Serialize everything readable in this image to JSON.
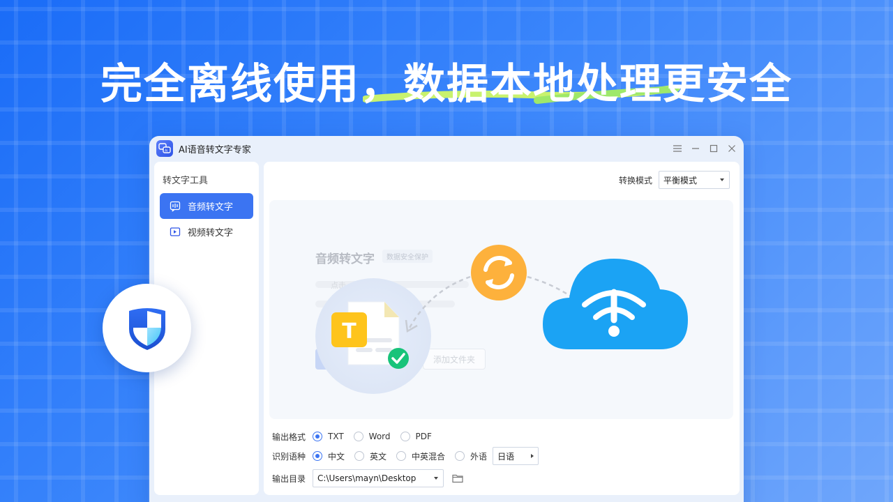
{
  "headline": "完全离线使用，数据本地处理更安全",
  "app": {
    "title": "AI语音转文字专家",
    "logo_text": "Ai"
  },
  "sidebar": {
    "heading": "转文字工具",
    "items": [
      {
        "label": "音频转文字",
        "active": true,
        "icon": "audio-text-icon"
      },
      {
        "label": "视频转文字",
        "active": false,
        "icon": "video-text-icon"
      }
    ]
  },
  "mode": {
    "label": "转换模式",
    "value": "平衡模式"
  },
  "drop_area": {
    "title": "音频转文字",
    "badge": "数据安全保护",
    "line_text": "点击",
    "add_folder": "添加文件夹",
    "doc_letter": "T"
  },
  "output_format": {
    "label": "输出格式",
    "options": [
      "TXT",
      "Word",
      "PDF"
    ],
    "selected": "TXT"
  },
  "language": {
    "label": "识别语种",
    "options": [
      "中文",
      "英文",
      "中英混合",
      "外语"
    ],
    "selected": "中文",
    "foreign_value": "日语"
  },
  "output_dir": {
    "label": "输出目录",
    "value": "C:\\Users\\mayn\\Desktop"
  },
  "colors": {
    "accent": "#3b74f2",
    "sync": "#fdb13c",
    "cloud": "#1ba3f4",
    "check": "#18c37a",
    "doc_badge": "#fec41c"
  }
}
